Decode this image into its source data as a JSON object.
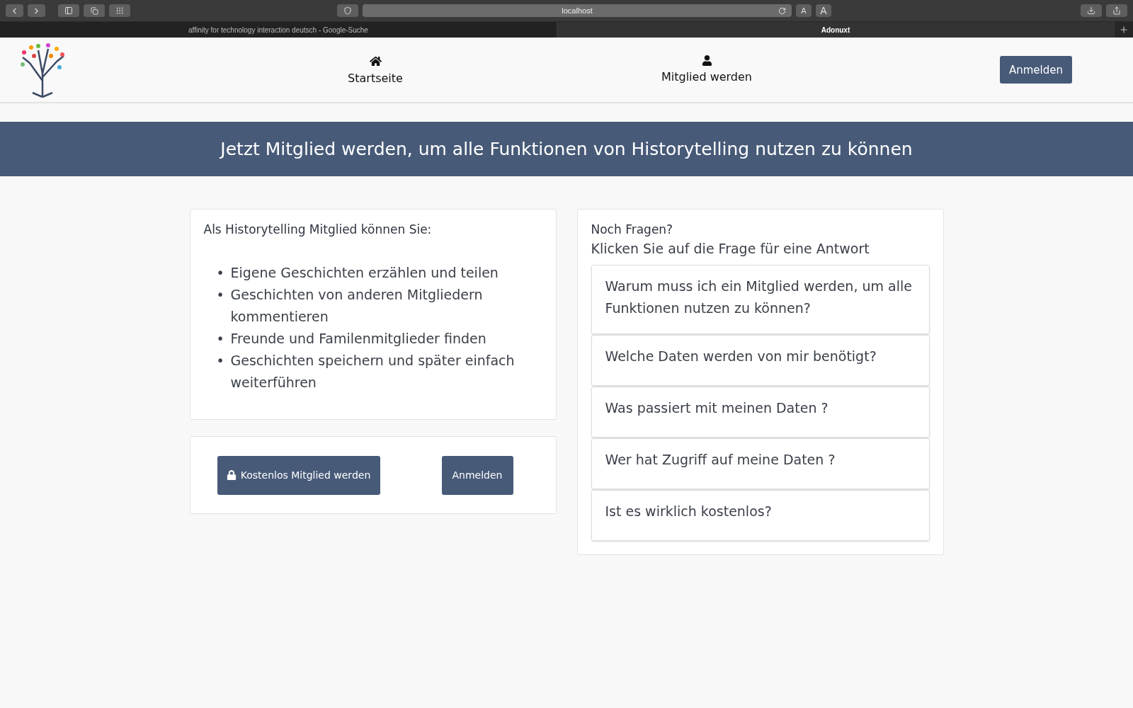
{
  "browser": {
    "address": "localhost",
    "text_size_buttons": [
      "A",
      "A"
    ],
    "tabs": [
      {
        "label": "affinity for technology interaction deutsch - Google-Suche",
        "selected": false
      },
      {
        "label": "Adonuxt",
        "selected": true
      }
    ]
  },
  "nav": {
    "items": [
      {
        "label": "Startseite",
        "kind": "home"
      },
      {
        "label": "Mitglied werden",
        "kind": "user"
      }
    ],
    "login": "Anmelden"
  },
  "banner": "Jetzt Mitglied werden, um alle Funktionen von Historytelling nutzen zu können",
  "benefits": {
    "title": "Als Historytelling Mitglied können Sie:",
    "items": [
      {
        "marker": "•",
        "text": "Eigene Geschichten erzählen und teilen"
      },
      {
        "marker": "•",
        "text": "Geschichten von anderen Mitgliedern kommentieren"
      },
      {
        "marker": "•",
        "text": "Freunde und Familenmitglieder finden"
      },
      {
        "marker": "•",
        "text": "Geschichten speichern und später einfach weiterführen"
      }
    ]
  },
  "actions": {
    "register": "Kostenlos Mitglied werden",
    "login": "Anmelden"
  },
  "faq": {
    "title": "Noch Fragen?",
    "subtitle": "Klicken Sie auf die Frage für eine Antwort",
    "questions": [
      "Warum muss ich ein Mitglied werden, um alle Funktionen nutzen zu können?",
      "Welche Daten werden von mir benötigt?",
      "Was passiert mit meinen Daten ?",
      "Wer hat Zugriff auf meine Daten ?",
      "Ist es wirklich kostenlos?"
    ]
  }
}
